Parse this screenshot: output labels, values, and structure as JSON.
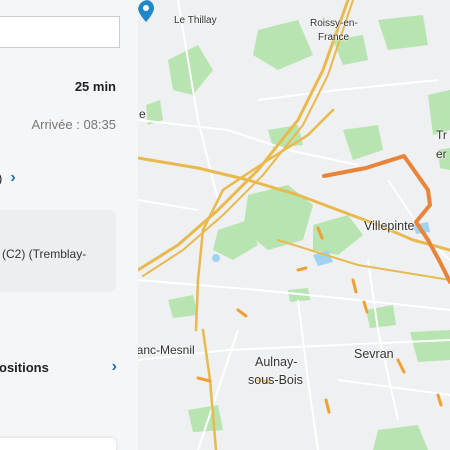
{
  "itinerary": {
    "duration": "25 min",
    "arrival": "Arrivée : 08:35",
    "line_fragment": ")",
    "step_text_line1": "(C2) (Tremblay-",
    "positions_label": "ositions"
  },
  "map": {
    "labels": {
      "le_thillay": "Le Thillay",
      "roissy_1": "Roissy-en-",
      "roissy_2": "France",
      "left_e": "e",
      "tr_1": "Tr",
      "tr_2": "er",
      "villepinte": "Villepinte",
      "blanc_mesnil": "Blanc-Mesnil",
      "aulnay_1": "Aulnay-",
      "aulnay_2": "sous-Bois",
      "sevran": "Sevran"
    },
    "colors": {
      "route": "#e8833a",
      "pin": "#1e88c8",
      "park": "#b7e4b0",
      "highway": "#e9b94e"
    }
  }
}
